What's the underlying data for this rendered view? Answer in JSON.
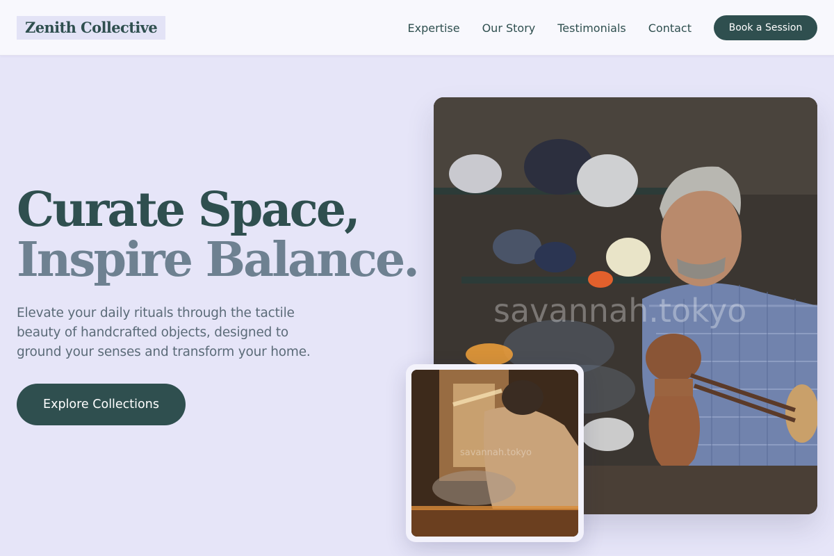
{
  "brand": {
    "name": "Zenith Collective"
  },
  "nav": {
    "links": [
      "Expertise",
      "Our Story",
      "Testimonials",
      "Contact"
    ],
    "cta": "Book a Session"
  },
  "hero": {
    "headline_line1": "Curate Space,",
    "headline_line2": "Inspire Balance.",
    "subtext": "Elevate your daily rituals through the tactile beauty of handcrafted objects, designed to ground your senses and transform your home.",
    "cta": "Explore Collections"
  },
  "images": {
    "main": {
      "watermark": "savannah.tokyo"
    },
    "secondary": {
      "watermark": "savannah.tokyo"
    }
  },
  "colors": {
    "background": "#e6e5f8",
    "header": "#f8f8fd",
    "accent": "#2f4f4f",
    "headline_secondary": "#6e8191",
    "body_text": "#5b6b78"
  }
}
